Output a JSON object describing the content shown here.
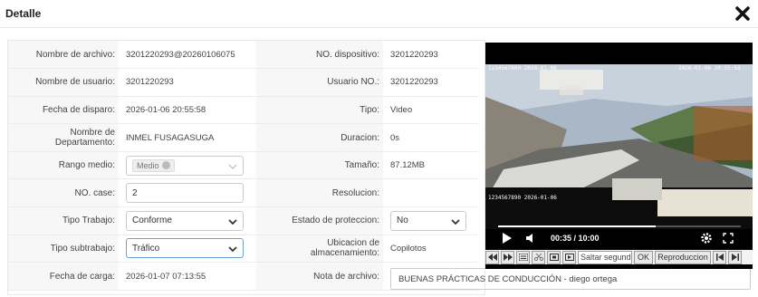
{
  "dialog": {
    "title": "Detalle"
  },
  "rows": [
    {
      "label1": "Nombre de archivo:",
      "value1": "3201220293@20260106075",
      "label2": "NO. dispositivo:",
      "value2": "3201220293"
    },
    {
      "label1": "Nombre de usuario:",
      "value1": "3201220293",
      "label2": "Usuario NO.:",
      "value2": "3201220293"
    },
    {
      "label1": "Fecha de disparo:",
      "value1": "2026-01-06 20:55:58",
      "label2": "Tipo:",
      "value2": "Video"
    },
    {
      "label1": "Nombre de Departamento:",
      "value1": "INMEL FUSAGASUGA",
      "label2": "Duracion:",
      "value2": "0s"
    },
    {
      "label1": "Rango medio:",
      "value1": "Medio",
      "label2": "Tamaño:",
      "value2": "87.12MB"
    },
    {
      "label1": "NO. case:",
      "value1": "2",
      "label2": "Resolucion:",
      "value2": ""
    },
    {
      "label1": "Tipo Trabajo:",
      "value1": "Conforme",
      "label2": "Estado de proteccion:",
      "value2": "No"
    },
    {
      "label1": "Tipo subtrabajo:",
      "value1": "Tráfico",
      "label2": "Ubicacion de almacenamiento:",
      "value2": "Copilotos"
    },
    {
      "label1": "Fecha de carga:",
      "value1": "2026-01-07 07:13:55",
      "label2": "Nota de archivo:",
      "value2": "BUENAS PRÁCTICAS DE CONDUCCIÓN - diego ortega"
    }
  ],
  "player": {
    "current_time": "00:35",
    "duration": "10:00",
    "time_display": "00:35 / 10:00",
    "progress": 0.65,
    "osd_left": "1234567890 2026-01-06",
    "osd_right": "2026-01-06 20:55:58",
    "osd_bottom": "1234567890 2026-01-06"
  },
  "toolbar": {
    "skip_placeholder": "Saltar segundo",
    "ok_label": "OK",
    "speed_label": "Reproduccion"
  }
}
